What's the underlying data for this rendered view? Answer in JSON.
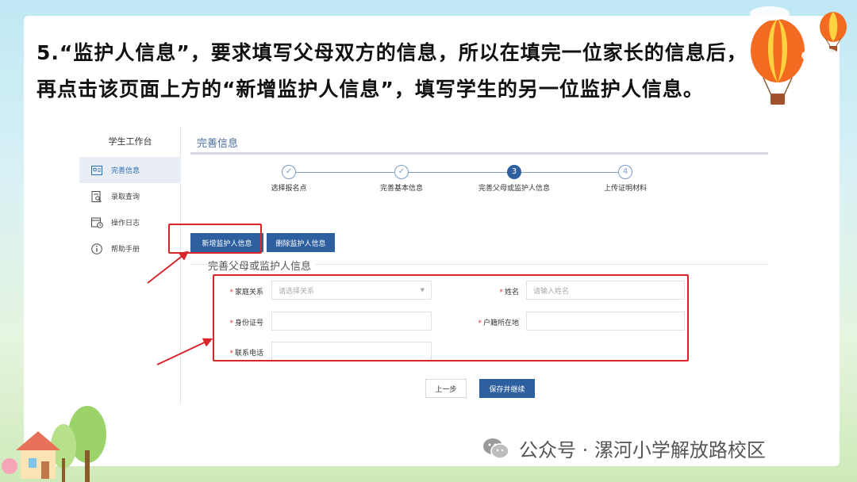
{
  "instruction": {
    "text": "5.“监护人信息”，要求填写父母双方的信息，所以在填完一位家长的信息后，再点击该页面上方的“新增监护人信息”，填写学生的另一位监护人信息。"
  },
  "sidebar": {
    "title": "学生工作台",
    "items": [
      {
        "label": "完善信息",
        "icon": "profile-card-icon",
        "active": true
      },
      {
        "label": "录取查询",
        "icon": "document-search-icon",
        "active": false
      },
      {
        "label": "操作日志",
        "icon": "calendar-clock-icon",
        "active": false
      },
      {
        "label": "帮助手册",
        "icon": "info-icon",
        "active": false
      }
    ]
  },
  "main": {
    "title": "完善信息",
    "steps": [
      {
        "label": "选择报名点",
        "mark": "✓",
        "status": "done"
      },
      {
        "label": "完善基本信息",
        "mark": "✓",
        "status": "done"
      },
      {
        "label": "完善父母或监护人信息",
        "mark": "3",
        "status": "current"
      },
      {
        "label": "上传证明材料",
        "mark": "4",
        "status": "todo"
      }
    ],
    "buttons": {
      "add_guardian": "新增监护人信息",
      "delete_guardian": "删除监护人信息",
      "prev": "上一步",
      "save_continue": "保存并继续"
    },
    "section_title": "完善父母或监护人信息",
    "form": {
      "relation": {
        "label": "家庭关系",
        "placeholder": "请选择关系"
      },
      "name": {
        "label": "姓名",
        "placeholder": "请输入姓名"
      },
      "id_number": {
        "label": "身份证号",
        "placeholder": ""
      },
      "household": {
        "label": "户籍所在地",
        "placeholder": ""
      },
      "phone": {
        "label": "联系电话",
        "placeholder": ""
      }
    }
  },
  "watermark": {
    "text": "公众号 · 漯河小学解放路校区"
  },
  "colors": {
    "accent": "#2e5f9e",
    "highlight": "#d9252a"
  }
}
